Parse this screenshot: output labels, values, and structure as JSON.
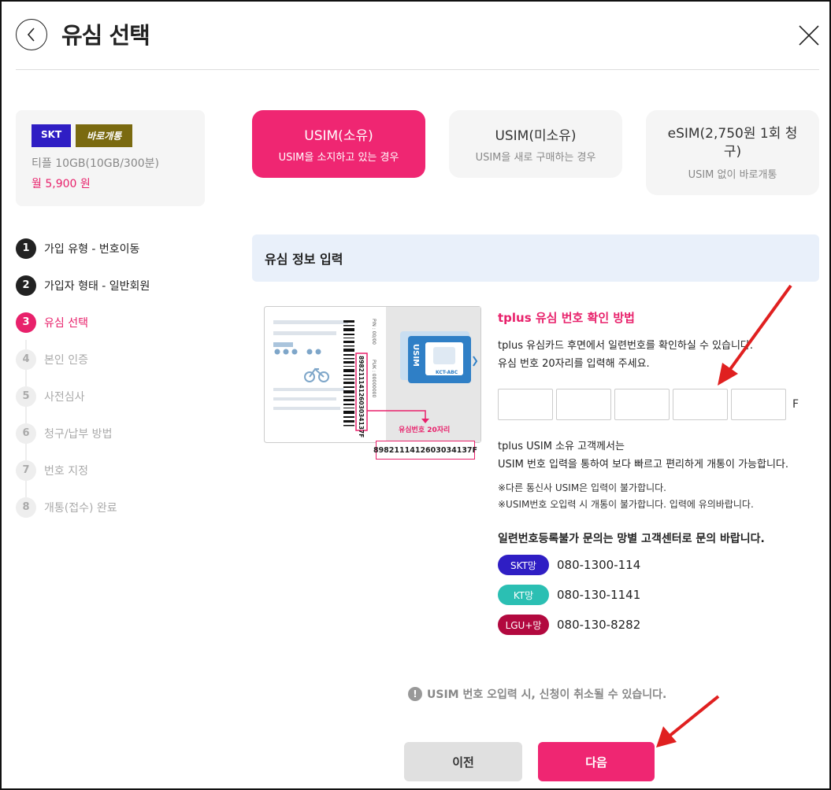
{
  "header": {
    "title": "유심 선택",
    "back_icon": "chevron-left-icon",
    "close_icon": "close-icon"
  },
  "plan": {
    "carrier": "SKT",
    "tag": "바로개통",
    "name": "티플 10GB(10GB/300분)",
    "price": "월 5,900 원"
  },
  "steps": [
    {
      "num": "1",
      "label": "가입 유형 - 번호이동",
      "state": "done"
    },
    {
      "num": "2",
      "label": "가입자 형태 - 일반회원",
      "state": "done"
    },
    {
      "num": "3",
      "label": "유심 선택",
      "state": "active"
    },
    {
      "num": "4",
      "label": "본인 인증",
      "state": "todo"
    },
    {
      "num": "5",
      "label": "사전심사",
      "state": "todo"
    },
    {
      "num": "6",
      "label": "청구/납부 방법",
      "state": "todo"
    },
    {
      "num": "7",
      "label": "번호 지정",
      "state": "todo"
    },
    {
      "num": "8",
      "label": "개통(접수) 완료",
      "state": "todo"
    }
  ],
  "sim_options": [
    {
      "title": "USIM(소유)",
      "sub": "USIM을 소지하고 있는 경우",
      "selected": true
    },
    {
      "title": "USIM(미소유)",
      "sub": "USIM을 새로 구매하는 경우",
      "selected": false
    },
    {
      "title": "eSIM(2,750원 1회 청구)",
      "sub": "USIM 없이 바로개통",
      "selected": false
    }
  ],
  "section": {
    "title": "유심 정보 입력"
  },
  "card_image": {
    "pin_label": "PIN : 00/00",
    "puk_label": "PUK : 00000000",
    "serial_vertical": "8982111412603034137F",
    "usim_label": "USIM",
    "chip_label": "KCT-ABC",
    "callout_label": "유심번호 20자리",
    "serial_box": "8982111412603034137F"
  },
  "guide": {
    "title": "tplus 유심 번호 확인 방법",
    "line1": "tplus 유심카드 후면에서 일련번호를 확인하실 수 있습니다.",
    "line2": "유심 번호 20자리를 입력해 주세요.",
    "suffix": "F"
  },
  "inputs": [
    "",
    "",
    "",
    "",
    ""
  ],
  "notes": {
    "n1": "tplus USIM 소유 고객께서는",
    "n2": "USIM 번호 입력을 통하여 보다 빠르고 편리하게 개통이 가능합니다.",
    "n3": "※다른 통신사 USIM은 입력이 불가합니다.",
    "n4": "※USIM번호 오입력 시 개통이 불가합니다. 입력에 유의바랍니다."
  },
  "contact": {
    "title": "일련번호등록불가 문의는 망별 고객센터로 문의 바랍니다.",
    "items": [
      {
        "label": "SKT망",
        "phone": "080-1300-114",
        "color": "#2f1ec4"
      },
      {
        "label": "KT망",
        "phone": "080-130-1141",
        "color": "#2bbfb3"
      },
      {
        "label": "LGU+망",
        "phone": "080-130-8282",
        "color": "#b2093f"
      }
    ]
  },
  "warning": {
    "icon": "exclamation-icon",
    "text": "USIM 번호 오입력 시, 신청이 취소될 수 있습니다."
  },
  "buttons": {
    "prev": "이전",
    "next": "다음"
  },
  "colors": {
    "accent": "#ef2672",
    "dark": "#222222",
    "section_bg": "#e9f0fa",
    "annotation_arrow": "#e02020"
  }
}
